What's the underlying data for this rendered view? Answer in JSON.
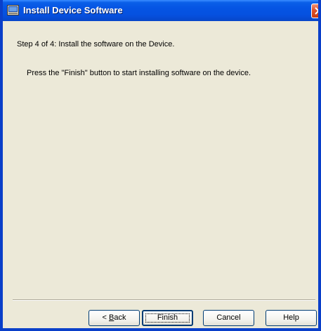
{
  "window": {
    "title": "Install Device Software"
  },
  "content": {
    "step": "Step 4 of 4:  Install the software on the Device.",
    "instruction": "Press the \"Finish\" button to start installing software on the device."
  },
  "buttons": {
    "back_prefix": "< ",
    "back_mnemonic": "B",
    "back_rest": "ack",
    "finish": "Finish",
    "cancel": "Cancel",
    "help": "Help"
  },
  "icons": {
    "app": "install-device-icon",
    "close": "close-icon"
  },
  "colors": {
    "titlebar": "#0554e3",
    "dialog_background": "#ece9d8",
    "close_button": "#e0552f"
  }
}
